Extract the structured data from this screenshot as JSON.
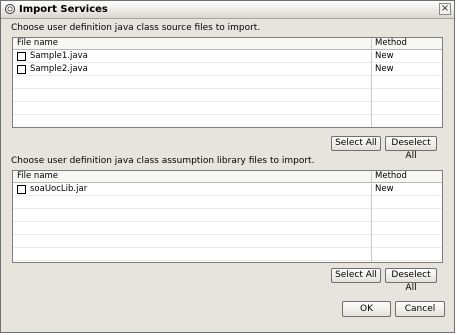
{
  "window": {
    "title": "Import Services"
  },
  "sources": {
    "instruction": "Choose user definition java class source files to import.",
    "columns": [
      "File name",
      "Method"
    ],
    "rows": [
      {
        "name": "Sample1.java",
        "method": "New"
      },
      {
        "name": "Sample2.java",
        "method": "New"
      }
    ],
    "select_all_label": "Select All",
    "deselect_all_label": "Deselect All"
  },
  "libraries": {
    "instruction": "Choose user definition java class assumption library files to import.",
    "columns": [
      "File name",
      "Method"
    ],
    "rows": [
      {
        "name": "soaUocLib.jar",
        "method": "New"
      }
    ],
    "select_all_label": "Select All",
    "deselect_all_label": "Deselect All"
  },
  "footer": {
    "ok_label": "OK",
    "cancel_label": "Cancel"
  }
}
